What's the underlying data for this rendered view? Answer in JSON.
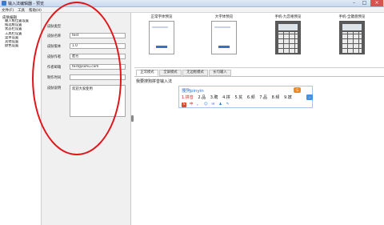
{
  "window": {
    "title": "输入法编辑器 - 预览",
    "controls": {
      "minimize": "–",
      "maximize": "□",
      "close": "×"
    }
  },
  "menu": {
    "items": [
      "文件(F)",
      "工具",
      "帮助(H)"
    ]
  },
  "tree": {
    "root": "皮肤编辑",
    "items": [
      "输入框位置设置",
      "候选框设置",
      "状态栏设置",
      "工具栏设置",
      "菜单设置",
      "其他设置",
      "颜色设置"
    ]
  },
  "form": {
    "fields": [
      {
        "label": "皮肤类型",
        "value": ""
      },
      {
        "label": "皮肤名称",
        "value": "test"
      },
      {
        "label": "皮肤版本",
        "value": "1.0"
      },
      {
        "label": "皮肤作者",
        "value": "匿名"
      },
      {
        "label": "作者邮箱",
        "value": "test@sohu.com"
      },
      {
        "label": "制作时间",
        "value": ""
      },
      {
        "label": "皮肤说明",
        "value": "欢迎大家使用"
      }
    ]
  },
  "preview": {
    "items": [
      "正常字体预览",
      "大字体预览",
      "手机-九宫格预览",
      "手机-全键盘预览"
    ]
  },
  "tabs": [
    "正常模式",
    "全屏模式",
    "无边框模式",
    "长句输入"
  ],
  "editor": {
    "text": "我要搜狗拼音输入法"
  },
  "ime": {
    "brand": "搜狗pinyin",
    "logo": "S",
    "candidates": [
      "1.拼音",
      "2.品",
      "3.聘",
      "4.拼",
      "5.贫",
      "6.频",
      "7.品",
      "8.频",
      "9.嫔"
    ],
    "next_arrow": "›",
    "tools": [
      "S",
      "中",
      "。",
      "☺",
      "✉",
      "♟",
      "✎"
    ]
  },
  "colors": {
    "annotation": "#e0161b",
    "ime_border": "#a9c4e6",
    "brand": "#2a6fd0"
  }
}
